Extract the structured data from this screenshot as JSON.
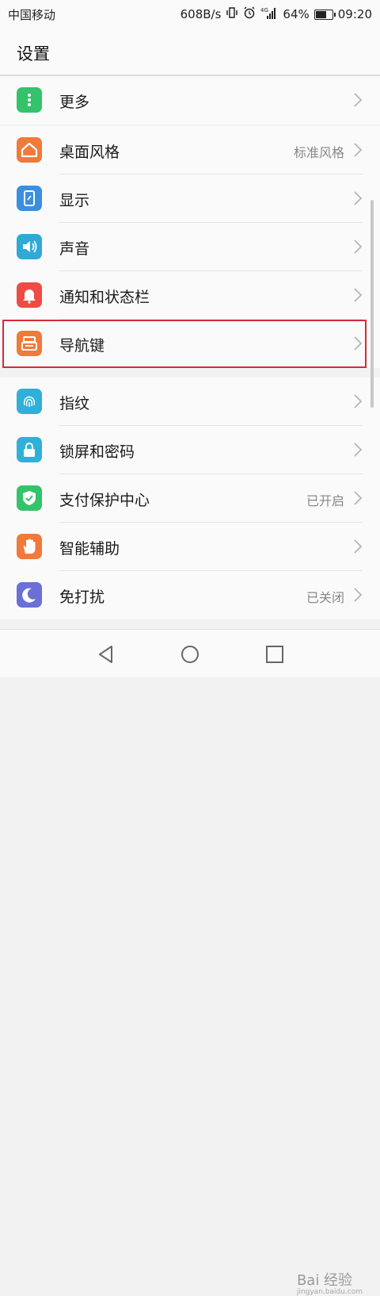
{
  "status_bar": {
    "carrier": "中国移动",
    "net_speed": "608B/s",
    "signal_label": "4G",
    "battery_percent": "64%",
    "time": "09:20"
  },
  "header": {
    "title": "设置"
  },
  "groups": [
    {
      "items": [
        {
          "label": "更多",
          "value": "",
          "icon": "more-vertical-icon",
          "color": "#34c36b"
        }
      ]
    },
    {
      "items": [
        {
          "label": "桌面风格",
          "value": "标准风格",
          "icon": "home-icon",
          "color": "#f07a3a"
        },
        {
          "label": "显示",
          "value": "",
          "icon": "display-phone-icon",
          "color": "#3b8fe0"
        },
        {
          "label": "声音",
          "value": "",
          "icon": "speaker-icon",
          "color": "#2fa9d6"
        },
        {
          "label": "通知和状态栏",
          "value": "",
          "icon": "bell-icon",
          "color": "#ee4b44"
        },
        {
          "label": "导航键",
          "value": "",
          "icon": "navigation-keys-icon",
          "color": "#f07a3a"
        }
      ]
    },
    {
      "items": [
        {
          "label": "指纹",
          "value": "",
          "icon": "fingerprint-icon",
          "color": "#2fb0d8"
        },
        {
          "label": "锁屏和密码",
          "value": "",
          "icon": "lock-icon",
          "color": "#2fb0d8"
        },
        {
          "label": "支付保护中心",
          "value": "已开启",
          "icon": "shield-check-icon",
          "color": "#34c36b"
        },
        {
          "label": "智能辅助",
          "value": "",
          "icon": "hand-icon",
          "color": "#f07a3a"
        },
        {
          "label": "免打扰",
          "value": "已关闭",
          "icon": "moon-icon",
          "color": "#6b6fd6"
        }
      ]
    }
  ],
  "battery_level": 0.64,
  "watermark": {
    "text": "Bai 经验",
    "sub": "jingyan.baidu.com"
  }
}
